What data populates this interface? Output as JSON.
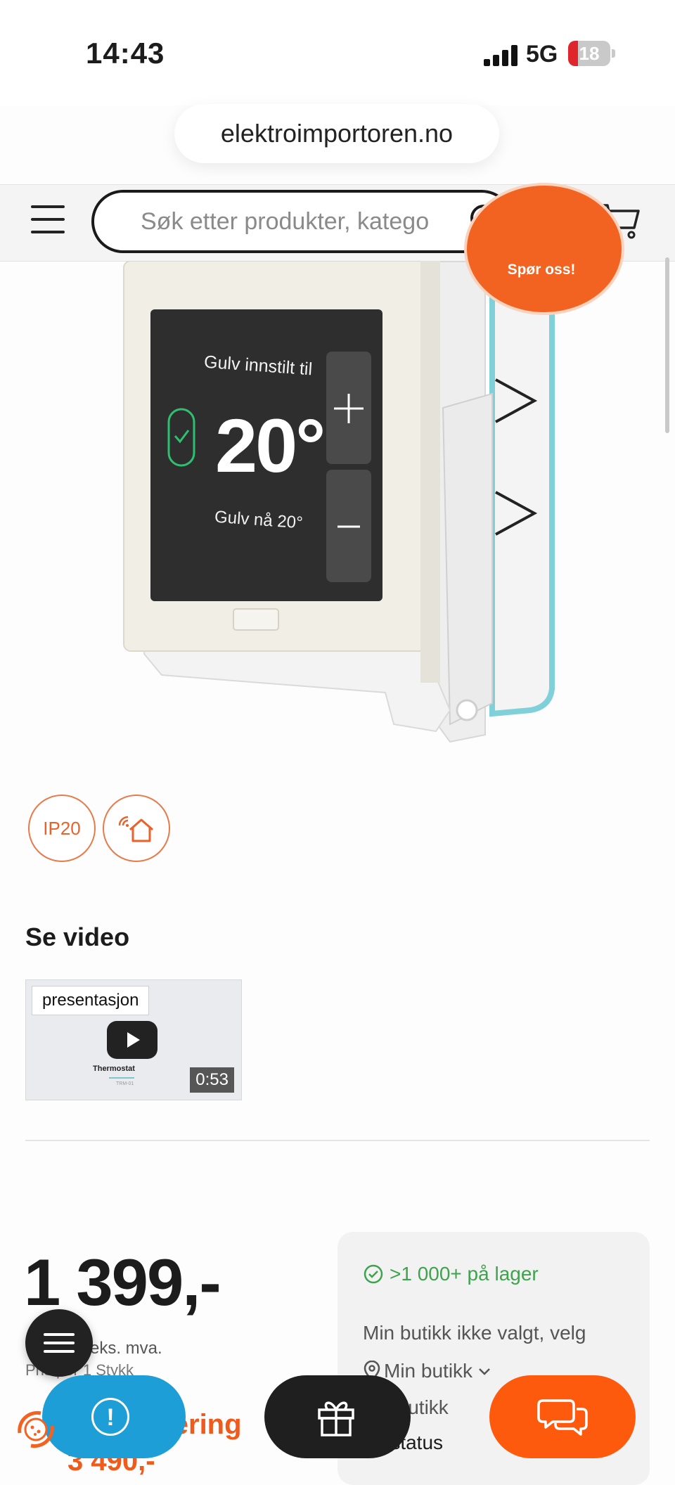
{
  "status_bar": {
    "time": "14:43",
    "network": "5G",
    "battery": "18"
  },
  "browser": {
    "url": "elektroimportoren.no"
  },
  "header": {
    "search_placeholder": "Søk etter produkter, katego"
  },
  "product_image": {
    "screen_top_text": "Gulv innstilt til",
    "temperature": "20°",
    "screen_bottom_text": "Gulv nå 20°",
    "ask_badge": "Spør oss!"
  },
  "spec_icons": {
    "ip_rating": "IP20"
  },
  "video_section": {
    "title": "Se video",
    "label": "presentasjon",
    "caption": "Thermostat",
    "subcaption": "TRM-01",
    "duration": "0:53"
  },
  "price": {
    "amount": "1 399,-",
    "ex_vat": "eks. mva.",
    "unit": "Pris per 1 Stykk"
  },
  "install": {
    "label": "ntering",
    "price": "3 490,-"
  },
  "stock": {
    "status": ">1 000+ på lager",
    "store_note": "Min butikk ikke valgt, velg",
    "my_store": "Min butikk",
    "web_store": "i-Butikk",
    "order_status": "rstatus"
  },
  "colors": {
    "brand_orange": "#f26322",
    "stock_green": "#3fa34d",
    "alert_blue": "#1e9ed6"
  }
}
